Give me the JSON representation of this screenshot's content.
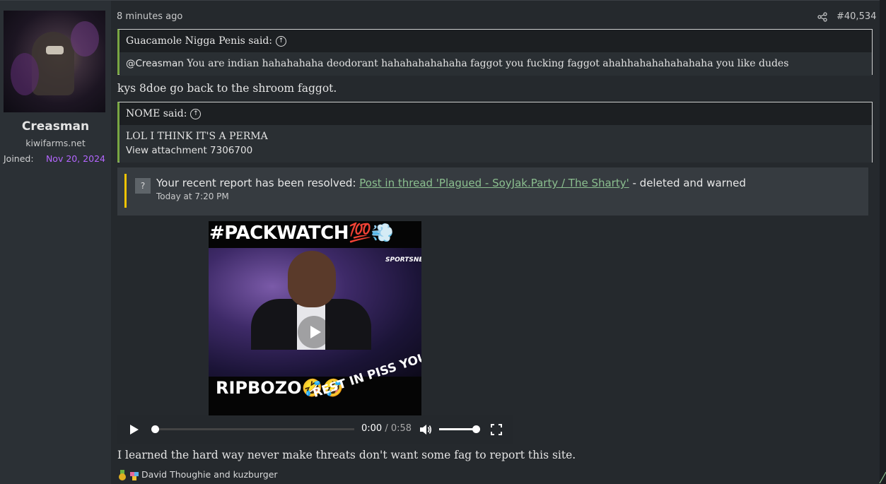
{
  "user": {
    "name": "Creasman",
    "title": "kiwifarms.net",
    "joined_label": "Joined:",
    "joined_value": "Nov 20, 2024"
  },
  "post": {
    "time": "8 minutes ago",
    "number": "#40,534",
    "quotes": [
      {
        "author_said": "Guacamole Nigga Penis said:",
        "mention": "@Creasman",
        "body": " You are indian hahahahaha deodorant hahahahahahaha faggot you fucking faggot ahahhahahahahahaha you like dudes"
      },
      {
        "author_said": "NOME said:",
        "line1": "LOL I THINK IT'S A PERMA",
        "line2": "View attachment 7306700"
      }
    ],
    "reply_after_quote1": "kys 8doe go back to the shroom faggot.",
    "notice": {
      "prefix": "Your recent report has been resolved: ",
      "link": "Post in thread 'Plagued - SoyJak.Party / The Sharty'",
      "suffix": " - deleted and warned",
      "time": "Today at 7:20 PM",
      "icon": "?"
    },
    "video": {
      "top_text": "#PACKWATCH💯💨",
      "brand": "SPORTSNET",
      "bottom_text": "RIPBOZO🤣🤣",
      "slanted_text": "REST IN PISS YOU WONT BE MISSED",
      "current_time": "0:00",
      "separator": " / ",
      "duration": "0:58",
      "progress": 0,
      "volume": 1.0
    },
    "closing_line": "I learned the hard way never make threats don't want some fag to report this site.",
    "reactions": "David Thoughie and kuzburger"
  },
  "colors": {
    "quote_accent": "#78a642",
    "notice_accent": "#f2c400",
    "link": "#8bbf8f",
    "joined_date": "#b466ff"
  }
}
